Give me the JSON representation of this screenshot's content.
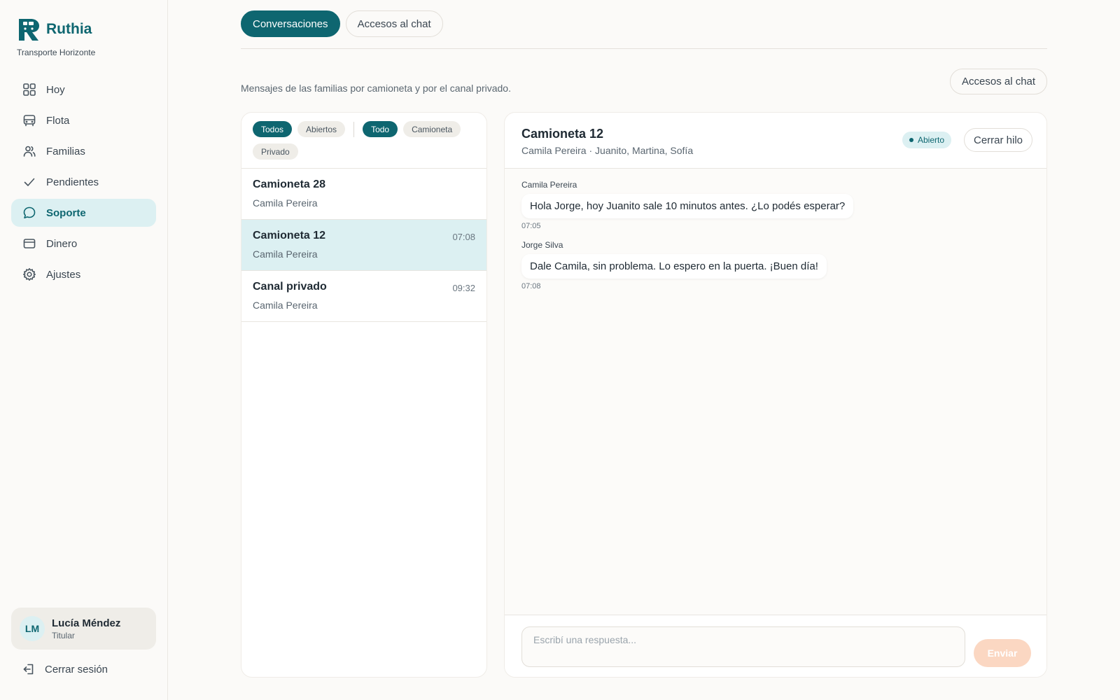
{
  "brand": {
    "name": "Ruthia",
    "company": "Transporte Horizonte"
  },
  "colors": {
    "accent": "#0e6670",
    "accent_soft": "#dcf0f2",
    "send_disabled": "#fbd7c2"
  },
  "sidebar": {
    "items": [
      {
        "label": "Hoy",
        "icon": "grid-icon"
      },
      {
        "label": "Flota",
        "icon": "bus-icon"
      },
      {
        "label": "Familias",
        "icon": "users-icon"
      },
      {
        "label": "Pendientes",
        "icon": "check-icon"
      },
      {
        "label": "Soporte",
        "icon": "chat-bubble-icon",
        "active": true
      },
      {
        "label": "Dinero",
        "icon": "card-icon"
      },
      {
        "label": "Ajustes",
        "icon": "gear-icon"
      }
    ],
    "user": {
      "initials": "LM",
      "name": "Lucía Méndez",
      "role": "Titular"
    },
    "logout_label": "Cerrar sesión"
  },
  "tabs": [
    {
      "label": "Conversaciones",
      "active": true
    },
    {
      "label": "Accesos al chat",
      "active": false
    }
  ],
  "description": "Mensajes de las familias por camioneta y por el canal privado.",
  "access_button": "Accesos al chat",
  "filters": {
    "status": [
      {
        "label": "Todos",
        "active": true
      },
      {
        "label": "Abiertos",
        "active": false
      }
    ],
    "channel": [
      {
        "label": "Todo",
        "active": true
      },
      {
        "label": "Camioneta",
        "active": false
      },
      {
        "label": "Privado",
        "active": false
      }
    ]
  },
  "conversations": [
    {
      "title": "Camioneta 28",
      "subtitle": "Camila Pereira",
      "time": ""
    },
    {
      "title": "Camioneta 12",
      "subtitle": "Camila Pereira",
      "time": "07:08",
      "selected": true
    },
    {
      "title": "Canal privado",
      "subtitle": "Camila Pereira",
      "time": "09:32"
    }
  ],
  "chat": {
    "title": "Camioneta 12",
    "subtitle": "Camila Pereira · Juanito, Martina, Sofía",
    "status": "Abierto",
    "close_label": "Cerrar hilo",
    "messages": [
      {
        "author": "Camila Pereira",
        "text": "Hola Jorge, hoy Juanito sale 10 minutos antes. ¿Lo podés esperar?",
        "time": "07:05"
      },
      {
        "author": "Jorge Silva",
        "text": "Dale Camila, sin problema. Lo espero en la puerta. ¡Buen día!",
        "time": "07:08"
      }
    ],
    "input_placeholder": "Escribí una respuesta...",
    "send_label": "Enviar"
  }
}
